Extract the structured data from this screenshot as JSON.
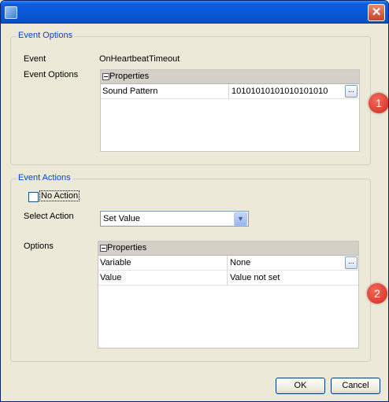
{
  "dialog": {
    "close_glyph": "✕"
  },
  "event_options": {
    "legend": "Event Options",
    "event_label": "Event",
    "event_value": "OnHeartbeatTimeout",
    "options_label": "Event Options",
    "grid": {
      "header": "Properties",
      "rows": [
        {
          "name": "Sound Pattern",
          "value": "10101010101010101010",
          "ellipsis": "..."
        }
      ]
    }
  },
  "event_actions": {
    "legend": "Event Actions",
    "no_action_label": "No Action",
    "no_action_checked": false,
    "select_label": "Select Action",
    "select_value": "Set Value",
    "options_label": "Options",
    "grid": {
      "header": "Properties",
      "rows": [
        {
          "name": "Variable",
          "value": "None",
          "ellipsis": "..."
        },
        {
          "name": "Value",
          "value": "Value not set"
        }
      ]
    }
  },
  "markers": [
    "1",
    "2"
  ],
  "buttons": {
    "ok": "OK",
    "cancel": "Cancel"
  },
  "icons": {
    "app": "app-icon",
    "close": "close-icon",
    "dropdown": "chevron-down-icon",
    "ellipsis": "ellipsis-icon",
    "collapse": "minus-box-icon"
  },
  "colors": {
    "title_bar": "#0a5fe0",
    "legend_text": "#0046d5",
    "dialog_bg": "#ece9d8",
    "marker": "#d42a1c"
  }
}
